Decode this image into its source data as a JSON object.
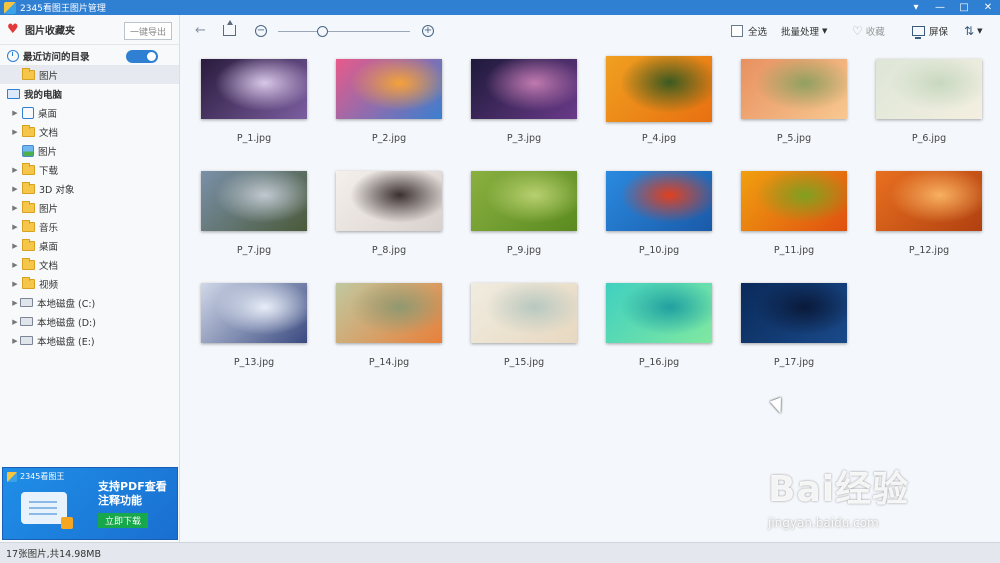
{
  "window": {
    "title": "2345看图王图片管理",
    "controls": [
      "▾",
      "—",
      "□",
      "✕"
    ]
  },
  "sidebar": {
    "favorites_label": "图片收藏夹",
    "export_button": "一键导出",
    "recent_label": "最近访问的目录",
    "recent_toggle_on": true,
    "recent_items": [
      "图片"
    ],
    "computer_label": "我的电脑",
    "tree": [
      {
        "label": "桌面",
        "icon": "desktop-edit-icon"
      },
      {
        "label": "文档",
        "icon": "documents-icon"
      },
      {
        "label": "图片",
        "icon": "pictures-icon"
      },
      {
        "label": "下载",
        "icon": "folder-icon"
      },
      {
        "label": "3D 对象",
        "icon": "folder-icon"
      },
      {
        "label": "图片",
        "icon": "folder-icon"
      },
      {
        "label": "音乐",
        "icon": "folder-icon"
      },
      {
        "label": "桌面",
        "icon": "folder-icon"
      },
      {
        "label": "文档",
        "icon": "folder-icon"
      },
      {
        "label": "视频",
        "icon": "folder-icon"
      },
      {
        "label": "本地磁盘 (C:)",
        "icon": "drive-icon"
      },
      {
        "label": "本地磁盘 (D:)",
        "icon": "drive-icon"
      },
      {
        "label": "本地磁盘 (E:)",
        "icon": "drive-icon"
      }
    ]
  },
  "ad": {
    "brand": "2345看图王",
    "text": "支持PDF查看注释功能",
    "button": "立即下载"
  },
  "toolbar": {
    "select_all": "全选",
    "batch": "批量处理",
    "favorite": "收藏",
    "fullscreen": "屏保",
    "zoom_level": 0.33
  },
  "images": [
    {
      "name": "P_1.jpg",
      "colors": [
        "#2a1b3d",
        "#7b5ea0",
        "#d9c7e8"
      ]
    },
    {
      "name": "P_2.jpg",
      "colors": [
        "#e85a8a",
        "#3a7fd0",
        "#f5a23a"
      ]
    },
    {
      "name": "P_3.jpg",
      "colors": [
        "#1e1a3a",
        "#6a3a8a",
        "#c07ab0"
      ]
    },
    {
      "name": "P_4.jpg",
      "colors": [
        "#f0a020",
        "#e87010",
        "#3a5a20"
      ]
    },
    {
      "name": "P_5.jpg",
      "colors": [
        "#e89060",
        "#f8c890",
        "#90a060"
      ]
    },
    {
      "name": "P_6.jpg",
      "colors": [
        "#dde6d8",
        "#f4efe0",
        "#c8d8c0"
      ]
    },
    {
      "name": "P_7.jpg",
      "colors": [
        "#7a90a8",
        "#4a5a3a",
        "#c0c8d0"
      ]
    },
    {
      "name": "P_8.jpg",
      "colors": [
        "#f5f0ec",
        "#d8d0cc",
        "#3a3030"
      ]
    },
    {
      "name": "P_9.jpg",
      "colors": [
        "#8ab040",
        "#5a8a20",
        "#b8d070"
      ]
    },
    {
      "name": "P_10.jpg",
      "colors": [
        "#2a8ae0",
        "#1a5aa8",
        "#e04020"
      ]
    },
    {
      "name": "P_11.jpg",
      "colors": [
        "#f0a010",
        "#e05010",
        "#80a020"
      ]
    },
    {
      "name": "P_12.jpg",
      "colors": [
        "#e87020",
        "#b04010",
        "#f8b060"
      ]
    },
    {
      "name": "P_13.jpg",
      "colors": [
        "#d0d8e8",
        "#3a4a80",
        "#e8eef8"
      ]
    },
    {
      "name": "P_14.jpg",
      "colors": [
        "#c0c8a0",
        "#e8803a",
        "#909870"
      ]
    },
    {
      "name": "P_15.jpg",
      "colors": [
        "#f0ece0",
        "#e8d8c0",
        "#b8c8c0"
      ]
    },
    {
      "name": "P_16.jpg",
      "colors": [
        "#40d0c0",
        "#80e8a0",
        "#20a0a0"
      ]
    },
    {
      "name": "P_17.jpg",
      "colors": [
        "#0a2a5a",
        "#1a4a8a",
        "#0a1a3a"
      ]
    }
  ],
  "status": "17张图片,共14.98MB",
  "watermark": {
    "main": "Bai经验",
    "sub": "jingyan.baidu.com"
  }
}
